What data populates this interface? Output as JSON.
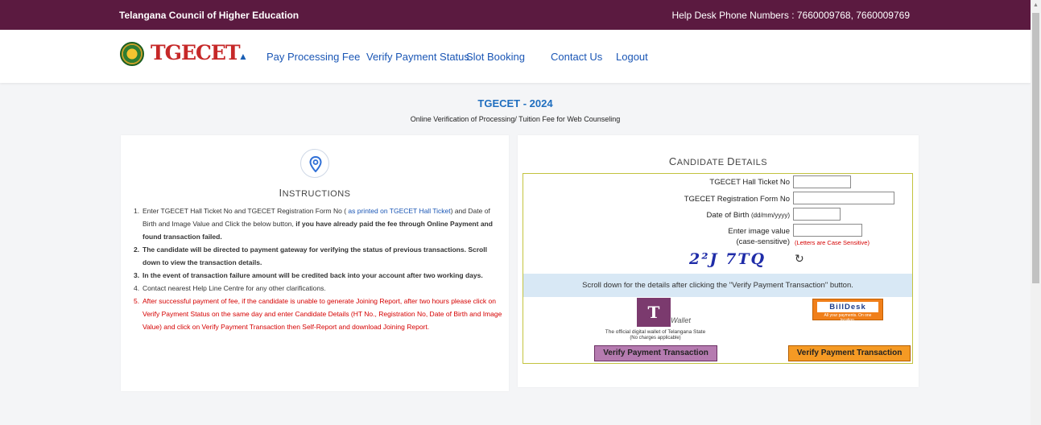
{
  "topbar": {
    "org": "Telangana Council of Higher Education",
    "help": "Help Desk Phone Numbers : 7660009768, 7660009769"
  },
  "navbar": {
    "logo_text": "TGECET",
    "home_icon": "home-icon",
    "links": [
      "Pay Processing Fee",
      "Verify Payment Status",
      "Slot Booking",
      "Contact Us",
      "Logout"
    ]
  },
  "page": {
    "title": "TGECET - 2024",
    "subtitle": "Online Verification of Processing/ Tuition Fee for Web Counseling"
  },
  "instructions": {
    "icon": "location-pin-icon",
    "heading_first": "I",
    "heading_rest": "NSTRUCTIONS",
    "items": [
      {
        "num": "1.",
        "part_a": "Enter TGECET Hall Ticket No and TGECET Registration Form No ( ",
        "part_link": "as printed on TGECET Hall Ticket",
        "part_b": ") and Date of Birth and Image Value and Click the below button, ",
        "part_bold": "if you have already paid the fee through Online Payment and found transaction failed."
      },
      {
        "num": "2.",
        "text": "The candidate will be directed to payment gateway for verifying the status of previous transactions. Scroll down to view the transaction details."
      },
      {
        "num": "3.",
        "text": "In the event of transaction failure amount will be credited back into your account after two working days."
      },
      {
        "num": "4.",
        "text": "Contact nearest Help Line Centre for any other clarifications."
      },
      {
        "num": "5.",
        "text": "After successful payment of fee, if the candidate is unable to generate Joining Report, after two hours please click on Verify Payment Status on the same day and enter Candidate Details (HT No., Registration No, Date of Birth and Image Value) and click on Verify Payment Transaction then Self-Report and download Joining Report."
      }
    ]
  },
  "candidate": {
    "heading_c": "C",
    "heading_andidate": "ANDIDATE ",
    "heading_d": "D",
    "heading_etails": "ETAILS",
    "hall_ticket_label": "TGECET Hall Ticket No",
    "hall_ticket_value": "",
    "reg_form_label": "TGECET Registration Form No",
    "reg_form_value": "",
    "dob_label": "Date of Birth",
    "dob_format": "(dd/mm/yyyy)",
    "dob_value": "",
    "image_label_1": "Enter image value",
    "image_label_2": "(case-sensitive)",
    "image_value": "",
    "case_note": "(Letters are Case Sensitive)",
    "captcha_text": "2²J 7TQ",
    "refresh_icon": "refresh-icon",
    "scroll_note": "Scroll down for the details after clicking the \"Verify Payment Transaction\" button.",
    "twallet": {
      "logo_letter": "T",
      "logo_tag": "Wallet",
      "caption_1": "The official digital wallet of Telangana State",
      "caption_2": "(No charges applicable)",
      "button": "Verify Payment Transaction"
    },
    "billdesk": {
      "logo": "BillDesk",
      "tag": "All your payments. On one location.",
      "button": "Verify Payment Transaction"
    }
  },
  "colors": {
    "topbar": "#5b1a40",
    "link": "#1a56b5",
    "title": "#1f6ebf",
    "alert": "#d50000",
    "twallet_button": "#b57bb0",
    "billdesk_button": "#f59a24"
  }
}
